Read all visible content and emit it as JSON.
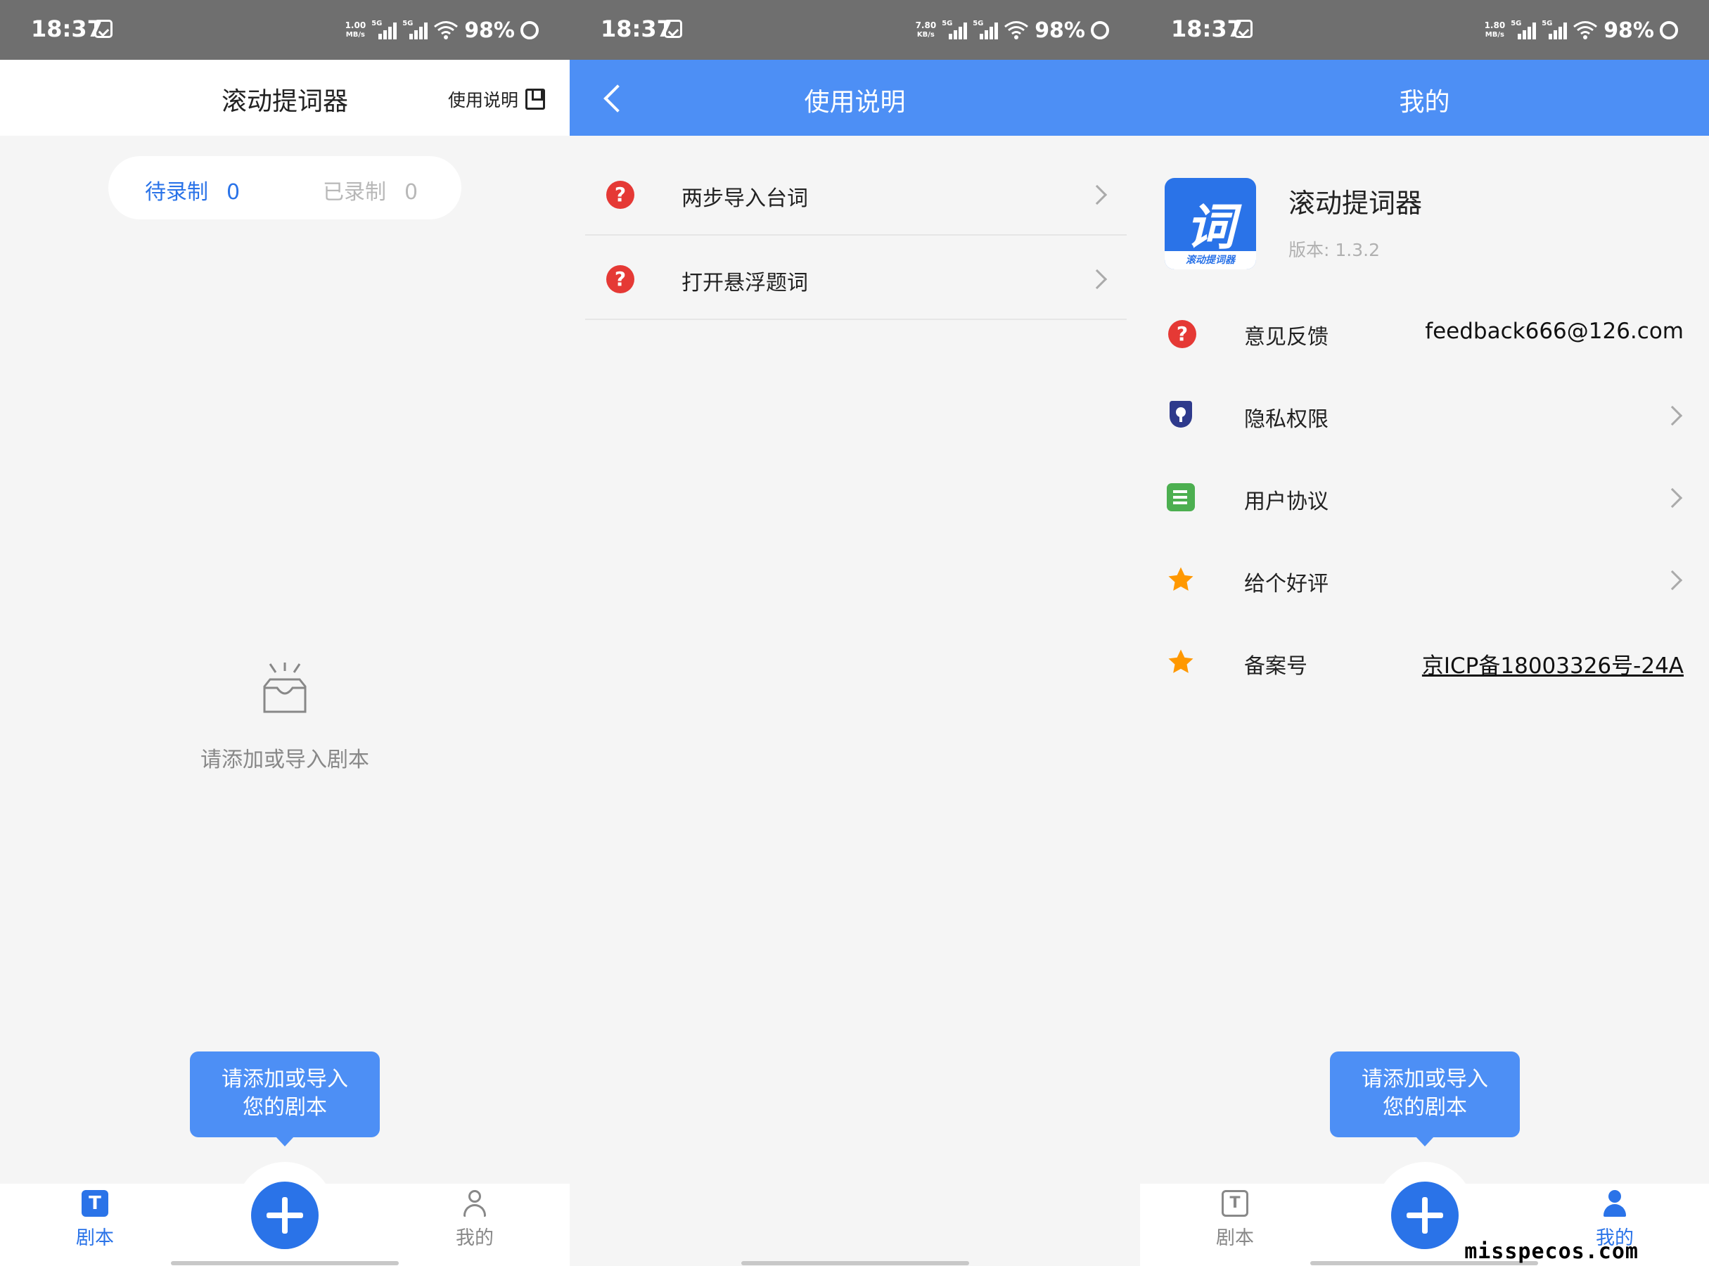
{
  "status": {
    "time": "18:37",
    "battery": "98%",
    "panels": [
      {
        "speed_value": "1.00",
        "speed_unit": "MB/s"
      },
      {
        "speed_value": "7.80",
        "speed_unit": "KB/s"
      },
      {
        "speed_value": "1.80",
        "speed_unit": "MB/s"
      }
    ],
    "network": "5G"
  },
  "scripts_page": {
    "title": "滚动提词器",
    "help_link": "使用说明",
    "tabs": [
      {
        "label": "待录制",
        "count": "0"
      },
      {
        "label": "已录制",
        "count": "0"
      }
    ],
    "empty_text": "请添加或导入剧本",
    "tooltip": [
      "请添加或导入",
      "您的剧本"
    ]
  },
  "help_page": {
    "title": "使用说明",
    "items": [
      {
        "label": "两步导入台词"
      },
      {
        "label": "打开悬浮题词"
      }
    ]
  },
  "me_page": {
    "title": "我的",
    "app_name": "滚动提词器",
    "app_logo_glyph": "词",
    "app_logo_caption": "滚动提词器",
    "version": "版本: 1.3.2",
    "rows": [
      {
        "label": "意见反馈",
        "value": "feedback666@126.com",
        "icon": "question-icon"
      },
      {
        "label": "隐私权限",
        "value": "",
        "icon": "shield-icon"
      },
      {
        "label": "用户协议",
        "value": "",
        "icon": "document-icon"
      },
      {
        "label": "给个好评",
        "value": "",
        "icon": "star-icon"
      },
      {
        "label": "备案号",
        "value": "京ICP备18003326号-24A",
        "icon": "star-icon"
      }
    ],
    "tooltip": [
      "请添加或导入",
      "您的剧本"
    ]
  },
  "tabbar": {
    "scripts_label": "剧本",
    "me_label": "我的"
  },
  "watermark": "misspecos.com",
  "colors": {
    "accent": "#2a73e8",
    "header_blue": "#4d8ff5",
    "danger": "#e53935",
    "star": "#ff9800",
    "doc": "#4caf50",
    "shield": "#2e3a8c"
  }
}
